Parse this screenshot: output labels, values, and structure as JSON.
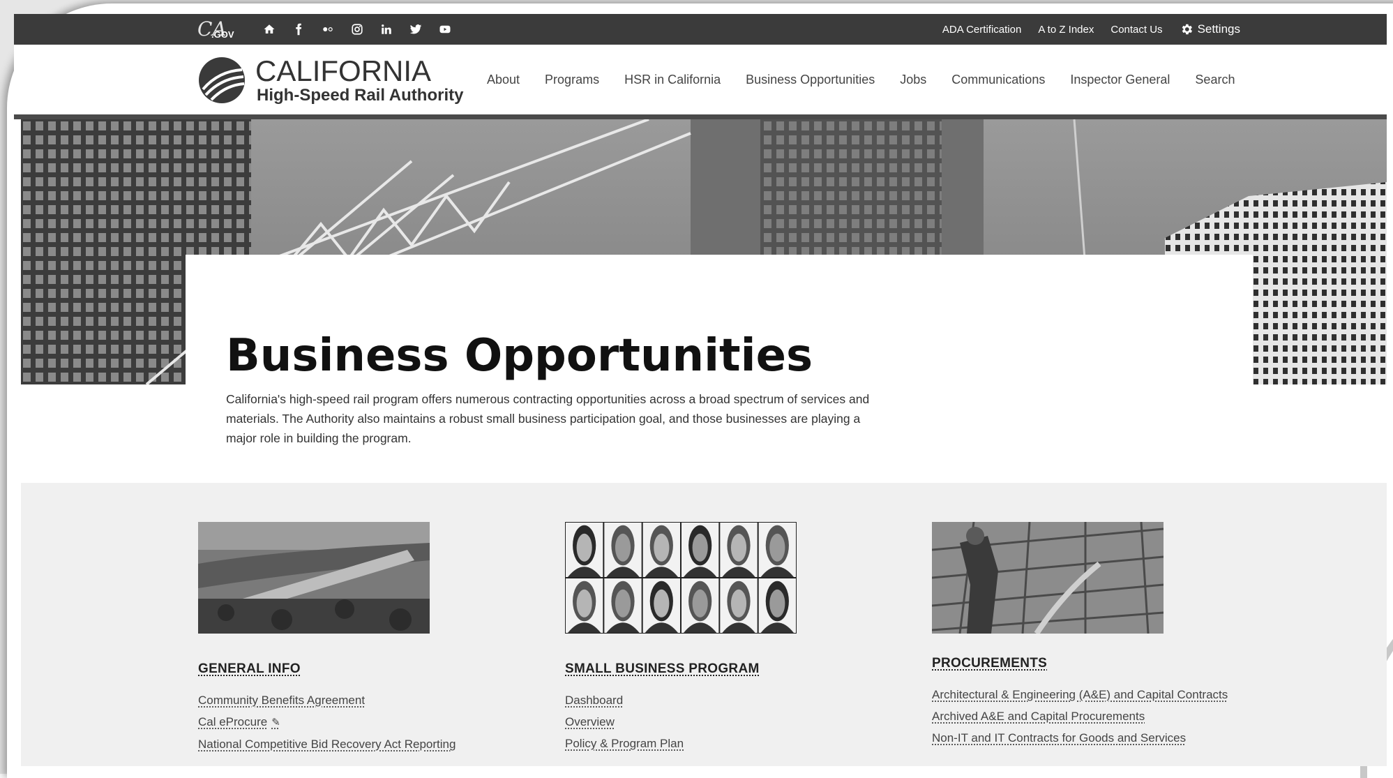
{
  "utility": {
    "ca_logo": {
      "script": "CA",
      "gov": ".GOV"
    },
    "social_icons": [
      "home-icon",
      "facebook-icon",
      "flickr-icon",
      "instagram-icon",
      "linkedin-icon",
      "twitter-icon",
      "youtube-icon"
    ],
    "links": [
      "ADA Certification",
      "A to Z Index",
      "Contact Us"
    ],
    "settings_label": "Settings"
  },
  "header": {
    "brand_title": "CALIFORNIA",
    "brand_subtitle": "High-Speed Rail Authority",
    "nav": [
      "About",
      "Programs",
      "HSR in California",
      "Business Opportunities",
      "Jobs",
      "Communications",
      "Inspector General",
      "Search"
    ]
  },
  "hero": {
    "title": "Business Opportunities",
    "intro": "California's high-speed rail program offers numerous contracting opportunities across a broad spectrum of services and materials. The Authority also maintains a robust small business participation goal, and those businesses are playing a major role in building the program."
  },
  "columns": [
    {
      "heading": "GENERAL INFO",
      "links": [
        "Community Benefits Agreement",
        "Cal eProcure",
        "National Competitive Bid Recovery Act Reporting"
      ]
    },
    {
      "heading": "SMALL BUSINESS PROGRAM",
      "links": [
        "Dashboard",
        "Overview",
        "Policy & Program Plan"
      ]
    },
    {
      "heading": "PROCUREMENTS",
      "links": [
        "Architectural & Engineering (A&E) and Capital Contracts",
        "Archived A&E and Capital Procurements",
        "Non-IT and IT Contracts for Goods and Services"
      ]
    }
  ],
  "external_link_glyph": "✎"
}
